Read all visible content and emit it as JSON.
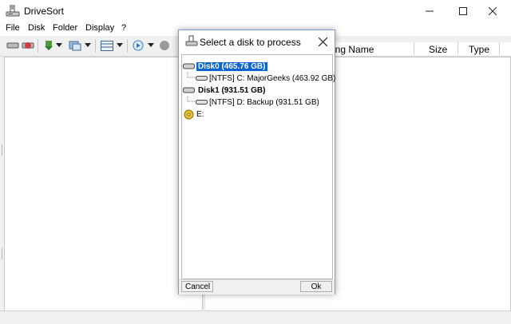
{
  "window": {
    "title": "DriveSort",
    "icon": "drive-icon"
  },
  "menu": [
    "File",
    "Disk",
    "Folder",
    "Display",
    "?"
  ],
  "file_list": {
    "columns": [
      "ong Name",
      "Size",
      "Type"
    ]
  },
  "dialog": {
    "title": "Select a disk to process",
    "tree": [
      {
        "label": "Disk0 (465.76 GB)",
        "level": 0,
        "selected": true
      },
      {
        "label": "[NTFS] C: MajorGeeks (463.92 GB)",
        "level": 1
      },
      {
        "label": "Disk1 (931.51 GB)",
        "level": 0
      },
      {
        "label": "[NTFS] D: Backup (931.51 GB)",
        "level": 1
      },
      {
        "label": "E:",
        "level": 0
      }
    ],
    "cancel_label": "Cancel",
    "ok_label": "Ok"
  },
  "colors": {
    "selection": "#0a64d2",
    "dialog_border": "#7b9cd0"
  }
}
